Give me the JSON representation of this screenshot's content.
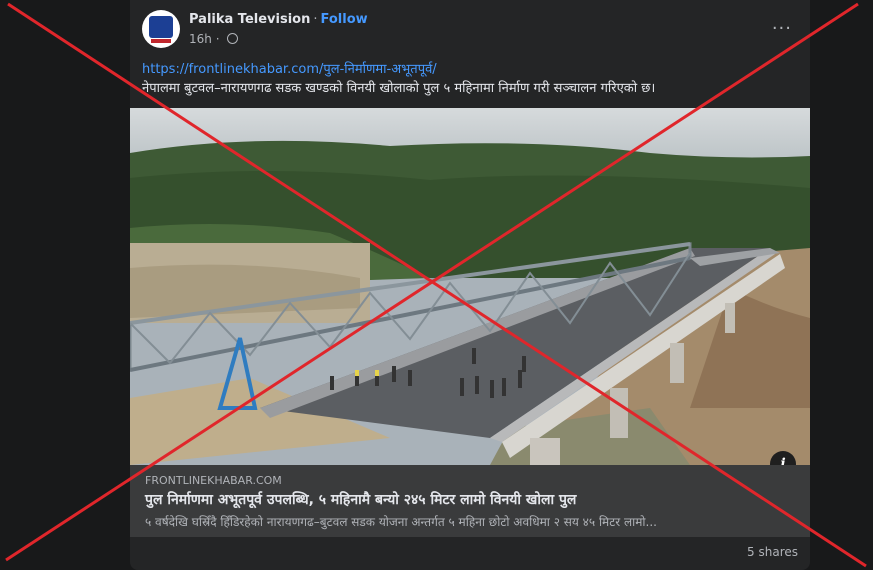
{
  "post": {
    "author": "Palika Television",
    "separator": "·",
    "follow_label": "Follow",
    "time": "16h",
    "menu_label": "···",
    "link": "https://frontlinekhabar.com/पुल-निर्माणमा-अभूतपूर्व/",
    "body": "नेपालमा बुटवल–नारायणगढ सडक खण्डको विनयी खोलाको पुल ५ महिनामा निर्माण गरी सञ्चालन गरिएको छ।"
  },
  "preview": {
    "domain": "FRONTLINEKHABAR.COM",
    "title": "पुल निर्माणमा अभूतपूर्व उपलब्धि, ५ महिनामै बन्यो २४५ मिटर लामो विनयी खोला पुल",
    "description": "५ वर्षदेखि घस्रिँदै हिँडिरहेको नारायणगढ–बुटवल सडक योजना अन्तर्गत ५ महिना छोटो अवधिमा २ सय ४५ मिटर लामो...",
    "info_label": "i"
  },
  "footer": {
    "shares": "5 shares"
  },
  "colors": {
    "link": "#4599ff",
    "card": "#242526",
    "cross": "#e0262b"
  },
  "icons": [
    "globe-icon",
    "more-options-icon",
    "info-icon"
  ]
}
